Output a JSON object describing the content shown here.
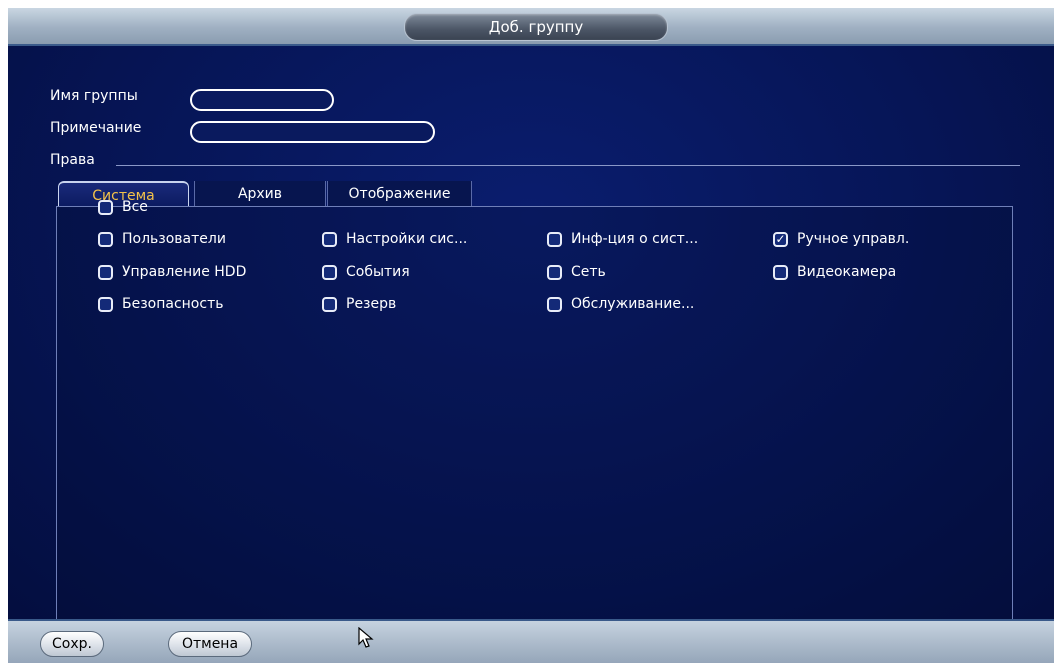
{
  "window": {
    "title": "Доб. группу"
  },
  "form": {
    "group_name_label": "Имя группы",
    "group_name_value": "",
    "note_label": "Примечание",
    "note_value": "",
    "rights_label": "Права"
  },
  "tabs": [
    {
      "label": "Система",
      "active": true
    },
    {
      "label": "Архив",
      "active": false
    },
    {
      "label": "Отображение",
      "active": false
    }
  ],
  "permissions": {
    "all": {
      "label": "Все",
      "checked": false
    },
    "items": [
      {
        "label": "Пользователи",
        "checked": false
      },
      {
        "label": "Настройки сис...",
        "checked": false
      },
      {
        "label": "Инф-ция о сист...",
        "checked": false
      },
      {
        "label": "Ручное управл.",
        "checked": true
      },
      {
        "label": "Управление HDD",
        "checked": false
      },
      {
        "label": "События",
        "checked": false
      },
      {
        "label": "Сеть",
        "checked": false
      },
      {
        "label": "Видеокамера",
        "checked": false
      },
      {
        "label": "Безопасность",
        "checked": false
      },
      {
        "label": "Резерв",
        "checked": false
      },
      {
        "label": "Обслуживание...",
        "checked": false
      }
    ]
  },
  "footer": {
    "save_label": "Сохр.",
    "cancel_label": "Отмена"
  }
}
